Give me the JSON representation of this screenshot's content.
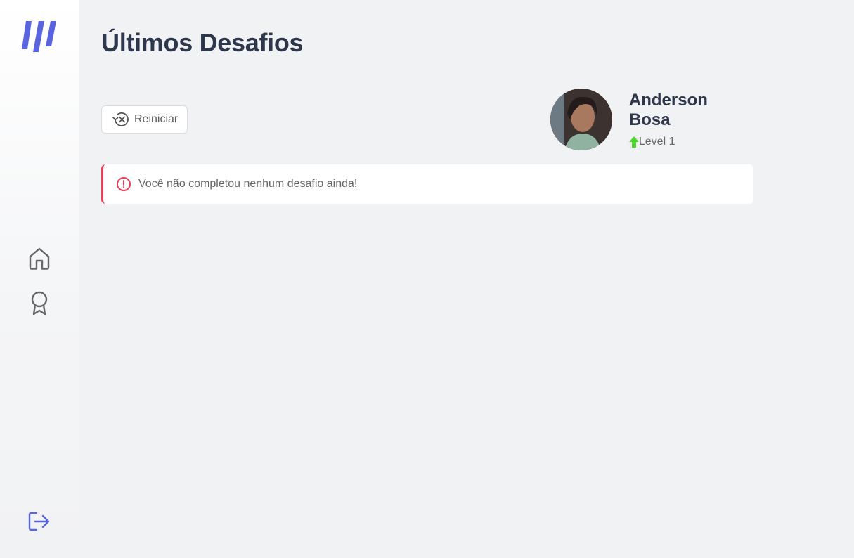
{
  "colors": {
    "accent": "#5965e0",
    "title": "#2e384d",
    "danger": "#e83f5b",
    "level_up": "#4cd62b"
  },
  "sidebar": {
    "logo_icon": "move-it-logo",
    "nav": [
      {
        "icon": "home-icon"
      },
      {
        "icon": "award-icon"
      }
    ],
    "logout_icon": "logout-icon"
  },
  "page": {
    "title": "Últimos Desafios"
  },
  "reset_button": {
    "label": "Reiniciar",
    "icon": "reset-icon"
  },
  "profile": {
    "name": "Anderson Bosa",
    "level_label": "Level 1",
    "level_icon": "level-up-icon"
  },
  "alert": {
    "message": "Você não completou nenhum desafio ainda!",
    "icon": "alert-circle-icon"
  }
}
